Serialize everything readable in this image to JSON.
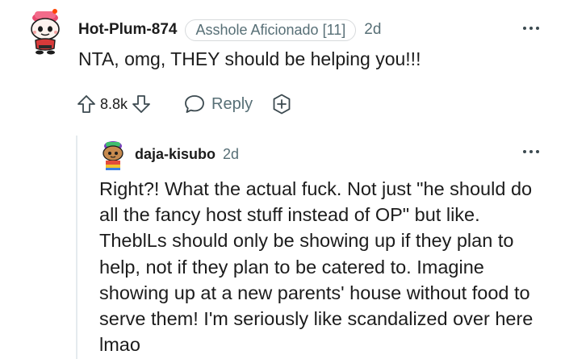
{
  "top_comment": {
    "username": "Hot-Plum-874",
    "flair": "Asshole Aficionado [11]",
    "time": "2d",
    "body": "NTA, omg, THEY should be helping you!!!",
    "score": "8.8k",
    "reply_label": "Reply",
    "avatar_icon": "snoo-avatar-icon",
    "more_icon": "more-options-icon"
  },
  "reply_comment": {
    "username": "daja-kisubo",
    "time": "2d",
    "body": "Right?! What the actual fuck. Not just \"he should do all the fancy host stuff instead of OP\" but like. TheblLs should only be showing up if they plan to help, not if they plan to be catered to. Imagine showing up at a new parents' house without food to serve them! I'm seriously like scandalized over here lmao",
    "avatar_icon": "snoo-avatar-icon",
    "more_icon": "more-options-icon"
  },
  "colors": {
    "text": "#1c1c1c",
    "meta": "#576f76",
    "border": "#d7dadc",
    "thread_line": "#e5ebee"
  }
}
